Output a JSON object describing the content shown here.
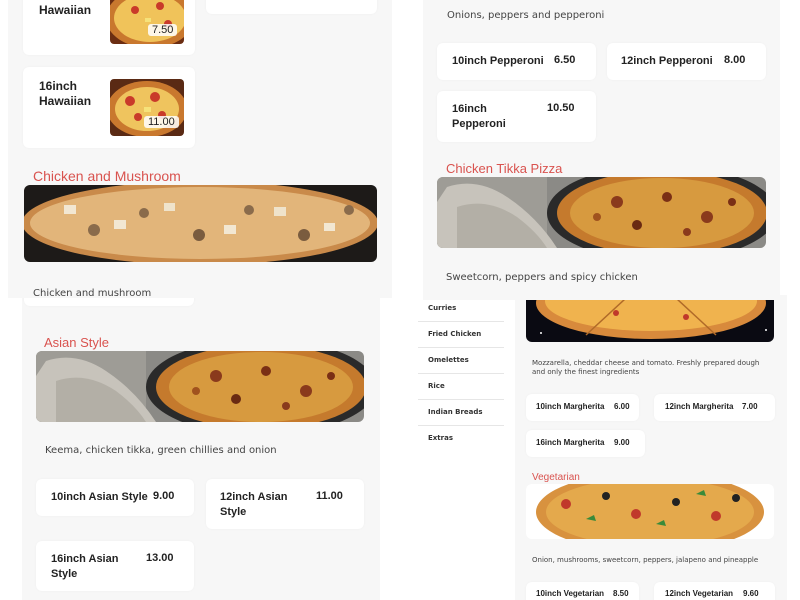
{
  "left_panel": {
    "cards_top": [
      {
        "name": "Hawaiian",
        "price": "7.50"
      },
      {
        "name": "16inch Hawaiian",
        "price": "11.00"
      }
    ],
    "chicken_mushroom": {
      "title": "Chicken and Mushroom",
      "description": "Chicken and mushroom"
    }
  },
  "asian_section": {
    "title": "Asian Style",
    "description": "Keema, chicken tikka, green chillies and onion",
    "items": [
      {
        "name": "10inch Asian Style",
        "price": "9.00"
      },
      {
        "name": "12inch Asian Style",
        "price": "11.00"
      },
      {
        "name": "16inch Asian Style",
        "price": "13.00"
      }
    ]
  },
  "pepperoni_section": {
    "description": "Onions, peppers and pepperoni",
    "items": [
      {
        "name": "10inch Pepperoni",
        "price": "6.50"
      },
      {
        "name": "12inch Pepperoni",
        "price": "8.00"
      },
      {
        "name": "16inch Pepperoni",
        "price": "10.50"
      }
    ]
  },
  "tikka_section": {
    "title": "Chicken Tikka Pizza",
    "description": "Sweetcorn, peppers and spicy chicken"
  },
  "sidebar": {
    "items": [
      "Curries",
      "Fried Chicken",
      "Omelettes",
      "Rice",
      "Indian Breads",
      "Extras"
    ]
  },
  "margherita_section": {
    "description": "Mozzarella, cheddar cheese and tomato. Freshly prepared dough and only the finest ingredients",
    "items": [
      {
        "name": "10inch Margherita",
        "price": "6.00"
      },
      {
        "name": "12inch Margherita",
        "price": "7.00"
      },
      {
        "name": "16inch Margherita",
        "price": "9.00"
      }
    ]
  },
  "vegetarian_section": {
    "title": "Vegetarian",
    "description": "Onion, mushrooms, sweetcorn, peppers, jalapeno and pineapple",
    "items": [
      {
        "name": "10inch Vegetarian",
        "price": "8.50"
      },
      {
        "name": "12inch Vegetarian",
        "price": "9.60"
      }
    ]
  },
  "colors": {
    "accent": "#d9534f",
    "panel_bg": "#f7f7f7",
    "card_bg": "#ffffff"
  }
}
